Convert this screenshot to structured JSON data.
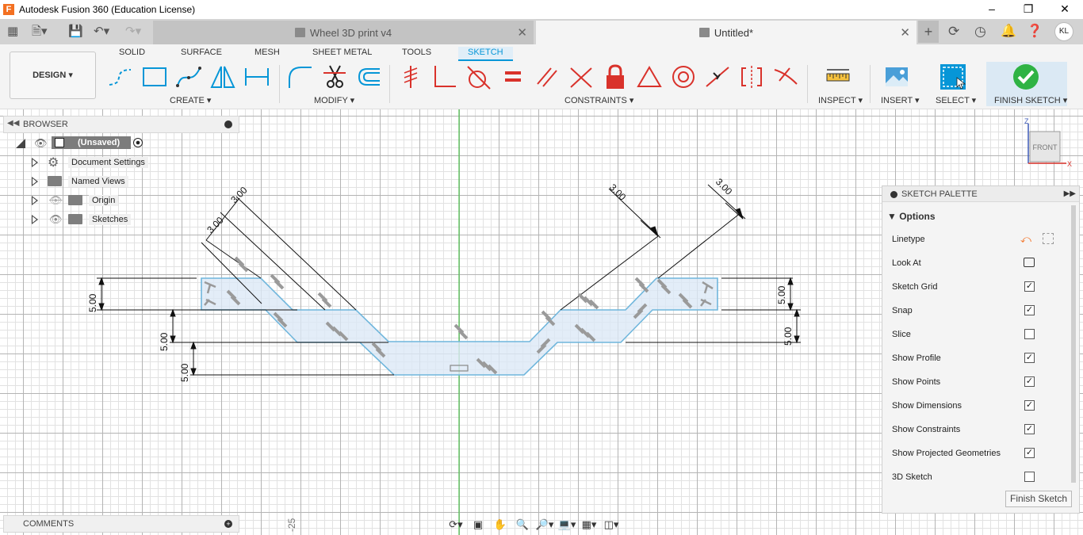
{
  "window": {
    "title": "Autodesk Fusion 360 (Education License)",
    "app_logo": "F"
  },
  "doc_tabs": [
    {
      "label": "Wheel 3D print v4"
    },
    {
      "label": "Untitled*"
    }
  ],
  "user": {
    "initials": "KL"
  },
  "workspace": {
    "label": "DESIGN"
  },
  "toolbar_tabs": [
    "SOLID",
    "SURFACE",
    "MESH",
    "SHEET METAL",
    "TOOLS",
    "SKETCH"
  ],
  "tool_groups": {
    "create": "CREATE",
    "modify": "MODIFY",
    "constraints": "CONSTRAINTS",
    "inspect": "INSPECT",
    "insert": "INSERT",
    "select": "SELECT",
    "finish": "FINISH SKETCH"
  },
  "browser": {
    "title": "BROWSER",
    "root": "(Unsaved)",
    "items": [
      {
        "label": "Document Settings"
      },
      {
        "label": "Named Views"
      },
      {
        "label": "Origin"
      },
      {
        "label": "Sketches"
      }
    ]
  },
  "sketch": {
    "dimensions": [
      "3.00",
      "3.00",
      "3.00",
      "3.00",
      "5.00",
      "5.00",
      "5.00",
      "5.00",
      "5.00"
    ],
    "ruler_label": "-25"
  },
  "viewcube": {
    "face": "FRONT",
    "axis_z": "Z",
    "axis_x": "X"
  },
  "palette": {
    "title": "SKETCH PALETTE",
    "section": "Options",
    "options": [
      {
        "label": "Linetype"
      },
      {
        "label": "Look At"
      },
      {
        "label": "Sketch Grid",
        "checked": true
      },
      {
        "label": "Snap",
        "checked": true
      },
      {
        "label": "Slice",
        "checked": false
      },
      {
        "label": "Show Profile",
        "checked": true
      },
      {
        "label": "Show Points",
        "checked": true
      },
      {
        "label": "Show Dimensions",
        "checked": true
      },
      {
        "label": "Show Constraints",
        "checked": true
      },
      {
        "label": "Show Projected Geometries",
        "checked": true
      },
      {
        "label": "3D Sketch",
        "checked": false
      }
    ],
    "finish_button": "Finish Sketch"
  },
  "comments": {
    "title": "COMMENTS"
  },
  "colors": {
    "accent": "#0696d7",
    "finish_green": "#2fb344",
    "profile_fill": "#dce9f6",
    "sketch_line": "#6fb6dc",
    "axis_green": "#4cc24c"
  }
}
